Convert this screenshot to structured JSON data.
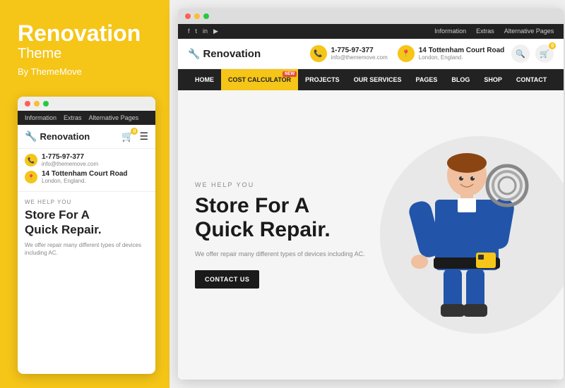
{
  "leftPanel": {
    "brandTitle": "Renovation",
    "brandSubtitle": "Theme",
    "brandBy": "By ThemeMove"
  },
  "mobilePreview": {
    "dots": [
      "red",
      "yellow",
      "green"
    ],
    "navLinks": [
      "Information",
      "Extras",
      "Alternative Pages"
    ],
    "logoText": "Renovation",
    "phone": "1-775-97-377",
    "email": "info@thememove.com",
    "address": "14 Tottenham Court Road",
    "addressSub": "London, England.",
    "helpTag": "WE HELP YOU",
    "heroTitle1": "Store For A",
    "heroTitle2": "Quick Repair.",
    "heroDesc": "We offer repair many different types of devices including AC."
  },
  "desktopPreview": {
    "navLinks": [
      "Information",
      "Extras",
      "Alternative Pages"
    ],
    "socialIcons": [
      "f",
      "t",
      "in",
      "yt"
    ],
    "logoText": "Renovation",
    "phone": "1-775-97-377",
    "phoneEmail": "info@thememove.com",
    "address": "14 Tottenham Court Road",
    "addressSub": "London, England.",
    "mainNav": [
      {
        "label": "HOME",
        "active": false
      },
      {
        "label": "COST CALCULATOR",
        "active": true,
        "badge": "NEW"
      },
      {
        "label": "PROJECTS",
        "active": false
      },
      {
        "label": "OUR SERVICES",
        "active": false
      },
      {
        "label": "PAGES",
        "active": false
      },
      {
        "label": "BLOG",
        "active": false
      },
      {
        "label": "SHOP",
        "active": false
      },
      {
        "label": "CONTACT",
        "active": false
      }
    ],
    "helpTag": "WE HELP YOU",
    "heroTitle1": "Store For A",
    "heroTitle2": "Quick Repair.",
    "heroDesc": "We offer repair many different types of devices including AC.",
    "heroBtn": "Contact Us"
  }
}
